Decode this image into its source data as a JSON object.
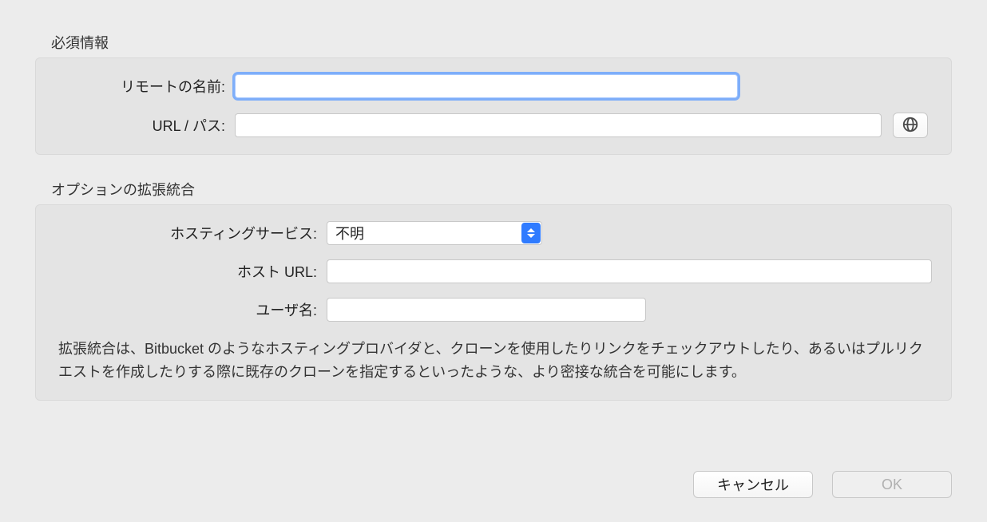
{
  "required": {
    "title": "必須情報",
    "remote_name_label": "リモートの名前:",
    "remote_name_value": "",
    "url_label": "URL / パス:",
    "url_value": "",
    "globe_icon_name": "globe-icon"
  },
  "optional": {
    "title": "オプションの拡張統合",
    "hosting_service_label": "ホスティングサービス:",
    "hosting_service_value": "不明",
    "host_url_label": "ホスト URL:",
    "host_url_value": "",
    "username_label": "ユーザ名:",
    "username_value": "",
    "description": "拡張統合は、Bitbucket のようなホスティングプロバイダと、クローンを使用したりリンクをチェックアウトしたり、あるいはプルリクエストを作成したりする際に既存のクローンを指定するといったような、より密接な統合を可能にします。"
  },
  "buttons": {
    "cancel": "キャンセル",
    "ok": "OK"
  }
}
